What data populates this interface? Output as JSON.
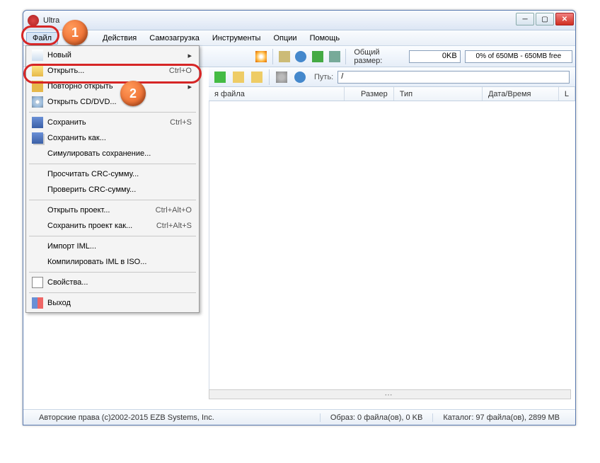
{
  "title": "Ultra",
  "menubar": [
    "Файл",
    "Действия",
    "Самозагрузка",
    "Инструменты",
    "Опции",
    "Помощь"
  ],
  "toolbar1": {
    "size_label": "Общий размер:",
    "size_value": "0KB",
    "size_bar": "0% of 650MB - 650MB free"
  },
  "toolbar2": {
    "path_label": "Путь:",
    "path_value": "/"
  },
  "columns": {
    "name": "я файла",
    "size": "Размер",
    "type": "Тип",
    "date": "Дата/Время",
    "lba": "L"
  },
  "dropdown": [
    {
      "label": "Новый",
      "arrow": true,
      "icon": "ic-new"
    },
    {
      "label": "Открыть...",
      "shortcut": "Ctrl+O",
      "icon": "ic-open"
    },
    {
      "label": "Повторно открыть",
      "arrow": true,
      "icon": "ic-reopen"
    },
    {
      "label": "Открыть CD/DVD...",
      "icon": "ic-cd"
    },
    {
      "sep": true
    },
    {
      "label": "Сохранить",
      "shortcut": "Ctrl+S",
      "icon": "ic-save"
    },
    {
      "label": "Сохранить как...",
      "icon": "ic-saveas"
    },
    {
      "label": "Симулировать сохранение..."
    },
    {
      "sep": true
    },
    {
      "label": "Просчитать CRC-сумму..."
    },
    {
      "label": "Проверить CRC-сумму..."
    },
    {
      "sep": true
    },
    {
      "label": "Открыть проект...",
      "shortcut": "Ctrl+Alt+O"
    },
    {
      "label": "Сохранить проект как...",
      "shortcut": "Ctrl+Alt+S"
    },
    {
      "sep": true
    },
    {
      "label": "Импорт IML..."
    },
    {
      "label": "Компилировать IML в ISO..."
    },
    {
      "sep": true
    },
    {
      "label": "Свойства...",
      "icon": "ic-props"
    },
    {
      "sep": true
    },
    {
      "label": "Выход",
      "icon": "ic-exit"
    }
  ],
  "status": {
    "copyright": "Авторские права (c)2002-2015 EZB Systems, Inc.",
    "image": "Образ: 0 файла(ов), 0 KB",
    "catalog": "Каталог: 97 файла(ов), 2899 MB"
  },
  "annotations": {
    "b1": "1",
    "b2": "2"
  }
}
